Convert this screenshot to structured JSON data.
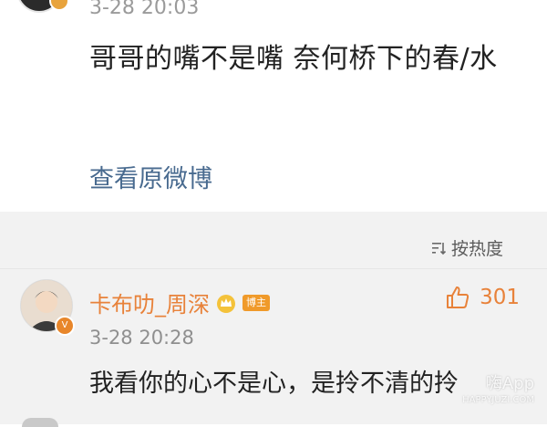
{
  "top_post": {
    "time": "3-28 20:03",
    "text": "哥哥的嘴不是嘴 奈何桥下的春/水",
    "view_original": "查看原微博"
  },
  "comments_section": {
    "sort_label": "按热度",
    "comment": {
      "username": "卡布叻_周深",
      "tag": "博主",
      "likes": "301",
      "time": "3-28 20:28",
      "text": "我看你的心不是心，是拎不清的拎"
    }
  },
  "watermark": {
    "main": "嗨App",
    "sub": "HAPPYJUZI.COM"
  },
  "colors": {
    "accent_orange": "#e8823a",
    "link_blue": "#486a8f",
    "comments_bg": "#f2f2f2"
  }
}
